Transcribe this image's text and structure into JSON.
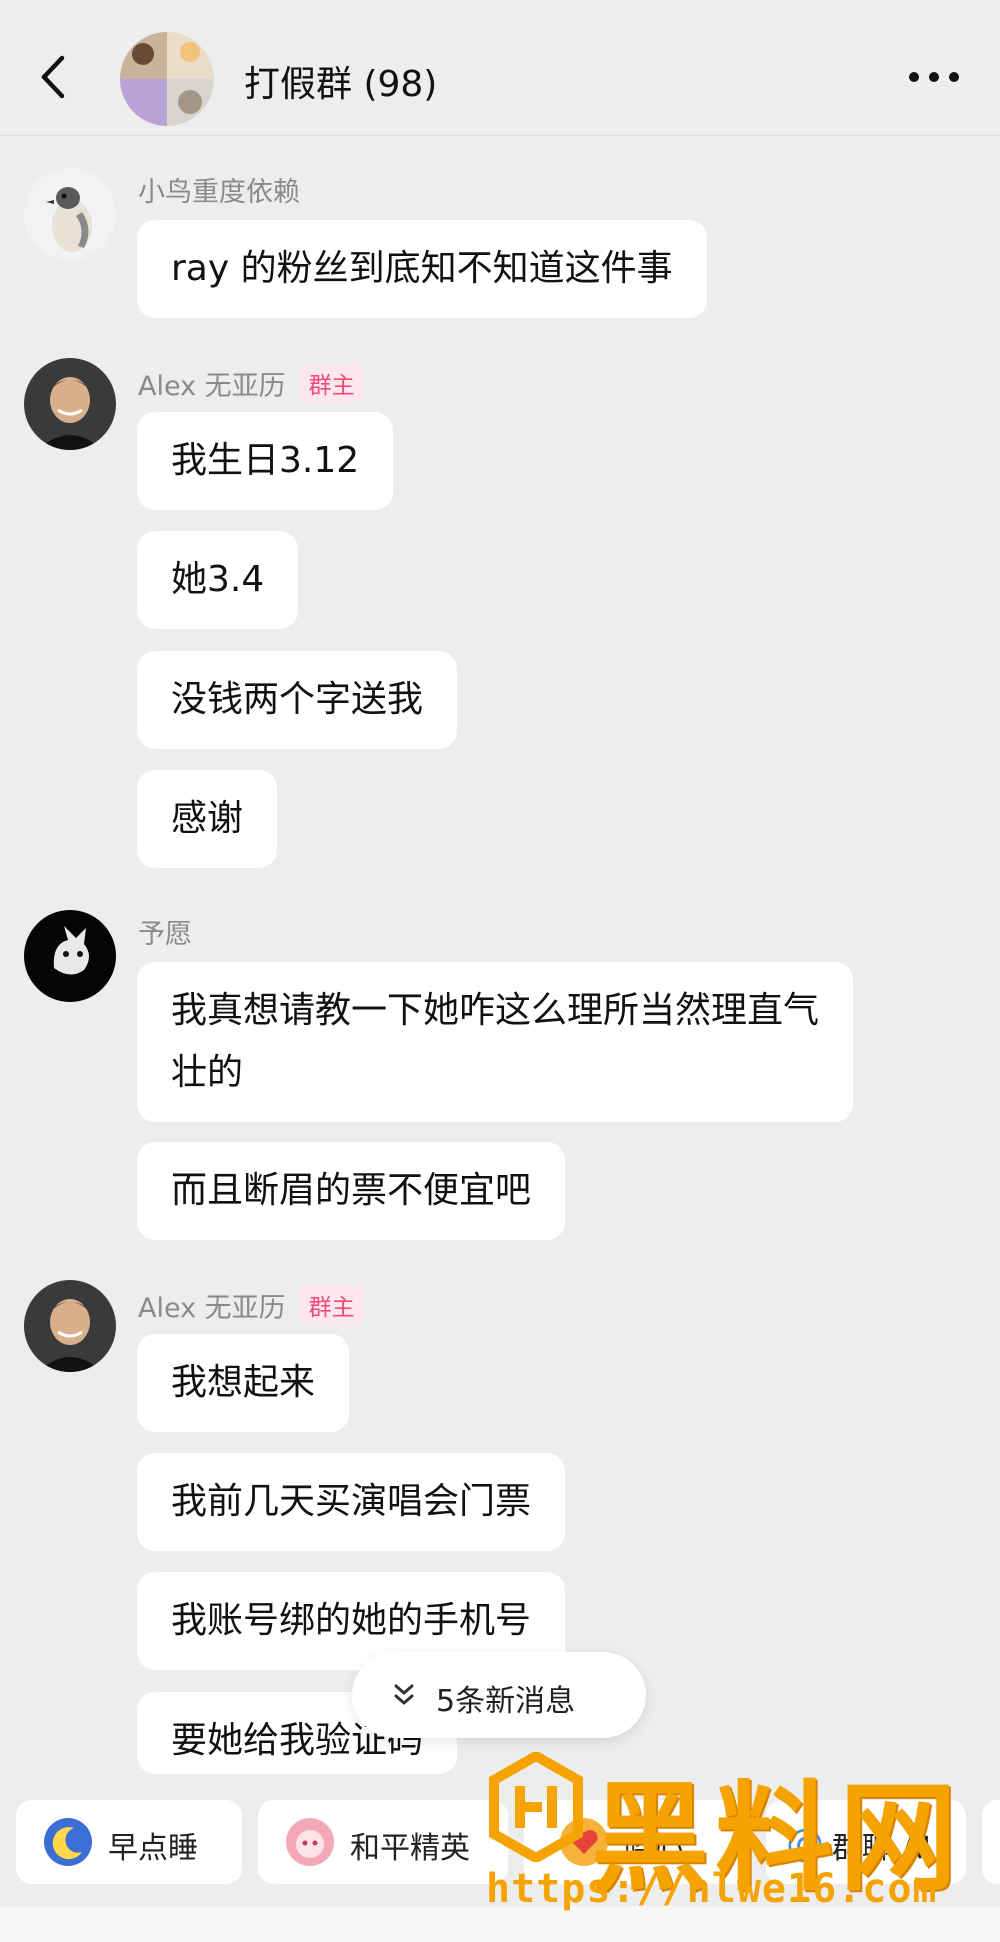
{
  "header": {
    "title": "打假群 (98)",
    "back_icon": "chevron-left-icon",
    "more_icon": "more-horizontal-icon"
  },
  "messages": [
    {
      "sender": "小鸟重度依赖",
      "badge": "",
      "bubbles": [
        "ray 的粉丝到底知不知道这件事"
      ]
    },
    {
      "sender": "Alex 无亚历",
      "badge": "群主",
      "bubbles": [
        "我生日3.12",
        "她3.4",
        "没钱两个字送我",
        "感谢"
      ]
    },
    {
      "sender": "予愿",
      "badge": "",
      "bubbles": [
        "我真想请教一下她咋这么理所当然理直气壮的",
        "而且断眉的票不便宜吧"
      ]
    },
    {
      "sender": "Alex 无亚历",
      "badge": "群主",
      "bubbles": [
        "我想起来",
        "我前几天买演唱会门票",
        "我账号绑的她的手机号",
        "要她给我验证码"
      ]
    }
  ],
  "new_messages": {
    "label": "5条新消息",
    "icon": "double-chevron-down-icon"
  },
  "quick_chips": [
    {
      "label": "早点睡",
      "icon": "moon-icon",
      "color": "#3b6fd6"
    },
    {
      "label": "和平精英",
      "icon": "game-character-icon",
      "color": "#f4a7b5"
    },
    {
      "label": "晓心",
      "icon": "heart-bubble-icon",
      "color": "#f7b23b"
    },
    {
      "label": "群聊 AI",
      "icon": "at-sign-icon",
      "color": "#3a8fe8"
    }
  ],
  "watermark": {
    "brand": "黑料网",
    "url": "https://hlwe16.com"
  },
  "colors": {
    "background": "#ededed",
    "bubble": "#ffffff",
    "badge_text": "#f14b77",
    "badge_bg": "#fde7ee",
    "watermark": "#f5a300"
  }
}
